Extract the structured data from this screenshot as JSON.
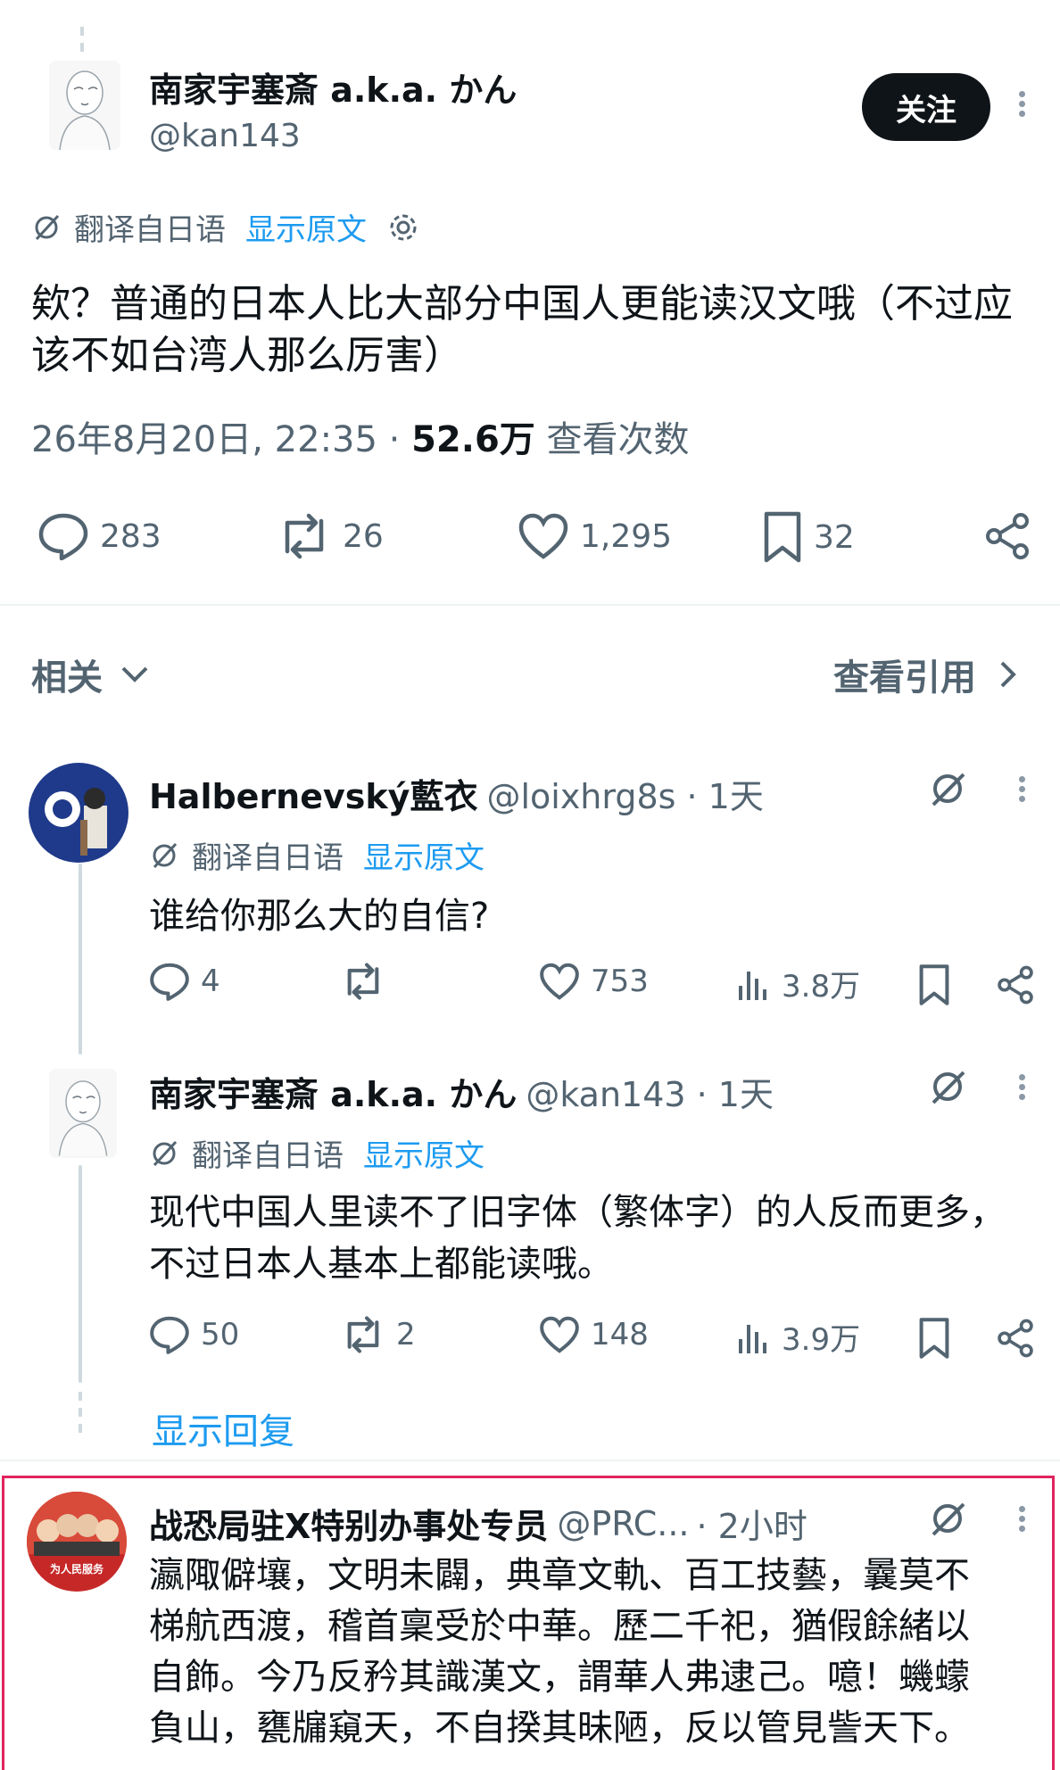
{
  "main_tweet": {
    "author_name": "南家宇塞斎 a.k.a. かん",
    "handle": "@kan143",
    "follow_label": "关注",
    "translate_label": "翻译自日语",
    "show_original_label": "显示原文",
    "text": "欸？普通的日本人比大部分中国人更能读汉文哦（不过应该不如台湾人那么厉害）",
    "time": "26年8月20日, 22:35 · ",
    "views_count": "52.6万",
    "views_label": " 查看次数",
    "stats": {
      "replies": "283",
      "retweets": "26",
      "likes": "1,295",
      "bookmarks": "32"
    }
  },
  "related_bar": {
    "related_label": "相关",
    "quotes_label": "查看引用"
  },
  "replies": [
    {
      "author_name": "Halbernevský藍衣",
      "handle_time": "@loixhrg8s · 1天",
      "translate_label": "翻译自日语",
      "show_original_label": "显示原文",
      "text": "谁给你那么大的自信?",
      "stats": {
        "replies": "4",
        "retweets": "",
        "likes": "753",
        "views": "3.8万"
      }
    },
    {
      "author_name": "南家宇塞斎 a.k.a. かん",
      "handle_time": "@kan143 · 1天",
      "translate_label": "翻译自日语",
      "show_original_label": "显示原文",
      "text": "现代中国人里读不了旧字体（繁体字）的人反而更多，不过日本人基本上都能读哦。",
      "stats": {
        "replies": "50",
        "retweets": "2",
        "likes": "148",
        "views": "3.9万"
      }
    }
  ],
  "show_replies_label": "显示回复",
  "highlighted_reply": {
    "author_name": "战恐局驻X特别办事处专员",
    "handle": "@PRC...",
    "time": " · 2小时",
    "avatar_text": "为人民服务",
    "text_lines": [
      "瀛陬僻壤，文明未闢，典章文軌、百工技藝，曩莫不",
      "梯航西渡，稽首稟受於中華。歷二千祀，猶假餘緒以",
      "自飾。今乃反矜其識漢文，謂華人弗逮己。噫！蟣蠓",
      "負山，甕牖窺天，不自揆其昧陋，反以管見訾天下。"
    ]
  },
  "colors": {
    "accent": "#1d9bf0",
    "text": "#0f1419",
    "muted": "#536471",
    "highlight_border": "#e0245e",
    "blue_avatar": "#1f3a8a"
  }
}
